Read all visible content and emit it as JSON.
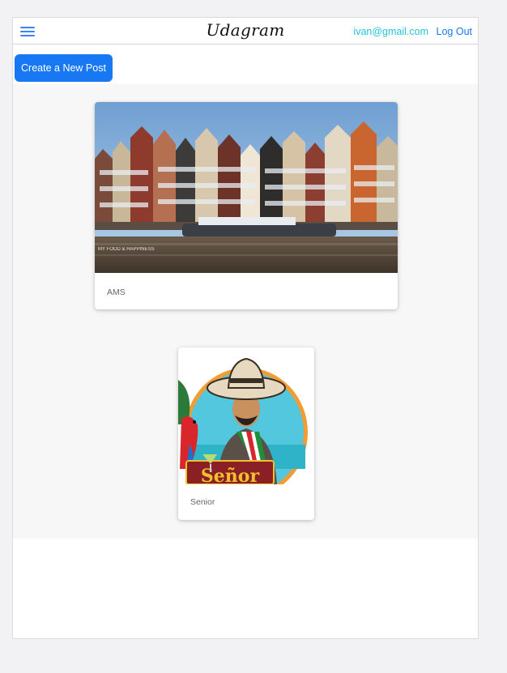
{
  "header": {
    "logo": "Udagram",
    "user_email": "ivan@gmail.com",
    "logout_label": "Log Out"
  },
  "actions": {
    "create_post_label": "Create a New Post"
  },
  "feed": {
    "posts": [
      {
        "caption": "AMS",
        "image": "amsterdam-canal-houses-photo",
        "watermark": "MY FOOD & HAPPINESS"
      },
      {
        "caption": "Senior",
        "image": "mexican-man-sombrero-parrot-illustration",
        "sign_text": "Señor"
      }
    ]
  },
  "colors": {
    "accent_blue": "#1877f2",
    "email_cyan": "#22c3d6",
    "feed_background": "#f7f7f7"
  }
}
